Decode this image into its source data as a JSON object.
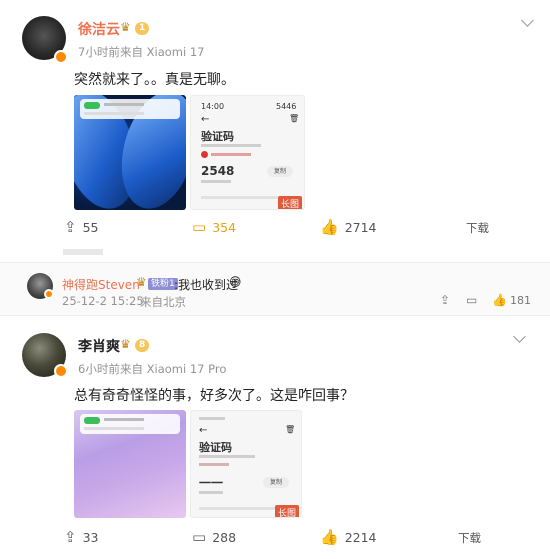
{
  "post1": {
    "user_name": "徐洁云",
    "level": "1",
    "time": "7小时前",
    "source": "来自 Xiaomi 17",
    "text": "突然就来了。。真是无聊。",
    "thumb_label": "长图",
    "screen": {
      "status": "14:00",
      "status_right": "5446",
      "title": "验证码",
      "code": "2548",
      "copy": "复制"
    },
    "actions": {
      "repost": "55",
      "comment": "354",
      "like": "2714",
      "download": "下载"
    }
  },
  "reply": {
    "user_name": "神得跑Steven",
    "tag": "铁粉1",
    "text": ":我也收到过",
    "time": "25-12-2 15:25",
    "location": "来自北京",
    "like_count": "181"
  },
  "post2": {
    "user_name": "李肖爽",
    "level": "8",
    "time": "6小时前",
    "source": "来自 Xiaomi 17 Pro",
    "text": "总有奇奇怪怪的事，好多次了。这是咋回事？",
    "thumb_label": "长图",
    "screen": {
      "title": "验证码",
      "code": "一一",
      "copy": "复制"
    },
    "actions": {
      "repost": "33",
      "comment": "288",
      "like": "2214",
      "download": "下载"
    }
  },
  "icons": {
    "repost": "⇪",
    "comment": "▭",
    "like": "👍",
    "crown": "♛",
    "emoji": "😅"
  },
  "colors": {
    "name_orange": "#eb7350",
    "highlight": "#e8a212",
    "meta_gray": "#939393"
  }
}
